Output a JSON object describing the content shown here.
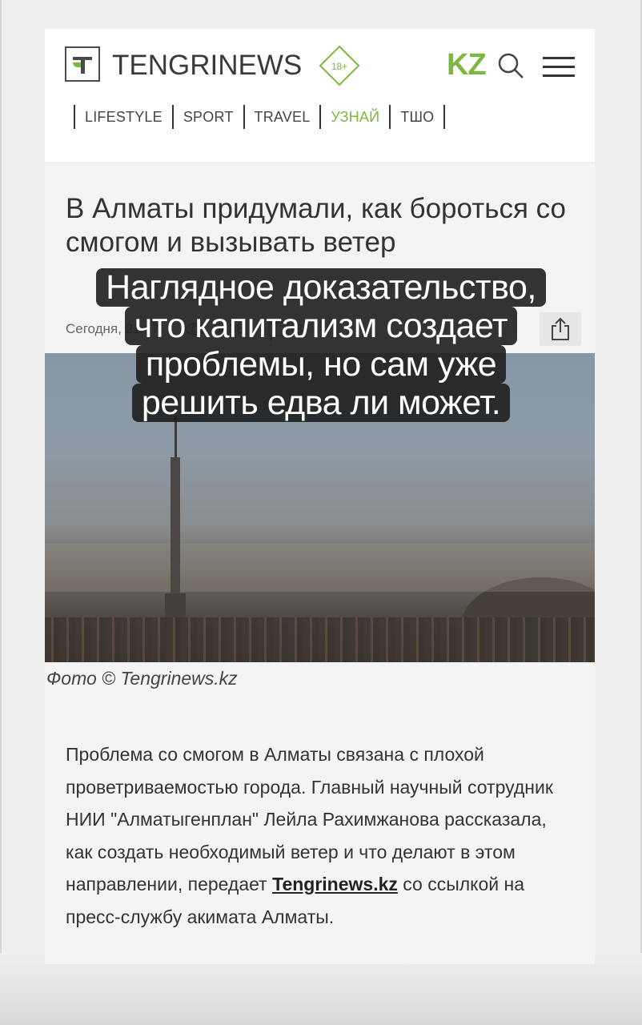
{
  "header": {
    "logo_text": "TENGRINEWS",
    "age_badge": "18+",
    "lang_link": "KZ",
    "nav": [
      "LIFESTYLE",
      "SPORT",
      "TRAVEL",
      "УЗНАЙ",
      "ТШО"
    ],
    "nav_active": "УЗНАЙ",
    "accent_color": "#7db83f"
  },
  "article": {
    "title": "В Алматы придумали, как бороться со смогом и вызывать ветер",
    "date": "Сегодня, 21:17",
    "views": "3438",
    "comments": "8",
    "photo_caption": "Фото © Tengrinews.kz",
    "body_before_link": "Проблема со смогом в Алматы связана с плохой проветриваемостью города. Главный научный сотрудник НИИ \"Алматыгенплан\" Лейла Рахимжанова рассказала, как создать необходимый ветер и что делают в этом направлении, передает ",
    "body_link": "Tengrinews.kz",
    "body_after_link": " со ссылкой на пресс-службу акимата Алматы."
  },
  "overlay": {
    "lines": [
      "Наглядное доказательство,",
      "что капитализм создает",
      "проблемы, но сам уже",
      "решить едва ли может."
    ]
  }
}
